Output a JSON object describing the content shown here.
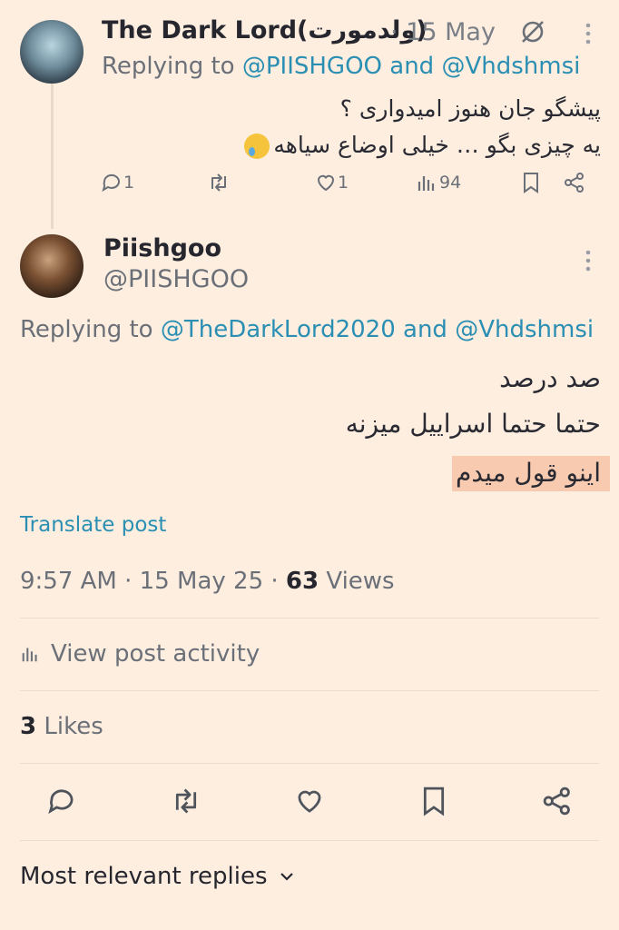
{
  "reply_tweet": {
    "author_name": "The Dark Lord(ولدمورت)",
    "date": "· 15 May",
    "replying_prefix": "Replying to",
    "replying_handles": "@PIISHGOO and @Vhdshmsi",
    "text_line1": "پیشگو جان هنوز امیدواری ؟",
    "text_line2": "یه چیزی بگو … خیلی اوضاع سیاهه",
    "counts": {
      "replies": "1",
      "retweets": "",
      "likes": "1",
      "views": "94"
    }
  },
  "main_tweet": {
    "author_name": "Piishgoo",
    "handle": "@PIISHGOO",
    "replying_prefix": "Replying to",
    "replying_handles": "@TheDarkLord2020 and @Vhdshmsi",
    "text_line1": "صد درصد",
    "text_line2": "حتما حتما اسراییل میزنه",
    "text_line3": "اینو قول میدم",
    "translate_label": "Translate post",
    "time": "9:57 AM · 15 May 25 · ",
    "views_count": "63",
    "views_label": " Views",
    "activity_label": "View post activity",
    "likes_count": "3",
    "likes_label": " Likes"
  },
  "replies_sort": {
    "label": "Most relevant replies"
  },
  "icons": [
    "grok-icon",
    "more-icon",
    "reply-icon",
    "retweet-icon",
    "like-icon",
    "views-icon",
    "bookmark-icon",
    "share-icon",
    "chevron-down-icon"
  ],
  "colors": {
    "background": "#fdeee0",
    "link": "#2b8fb3",
    "muted": "#6b7078",
    "highlight": "#f8cbb0"
  }
}
